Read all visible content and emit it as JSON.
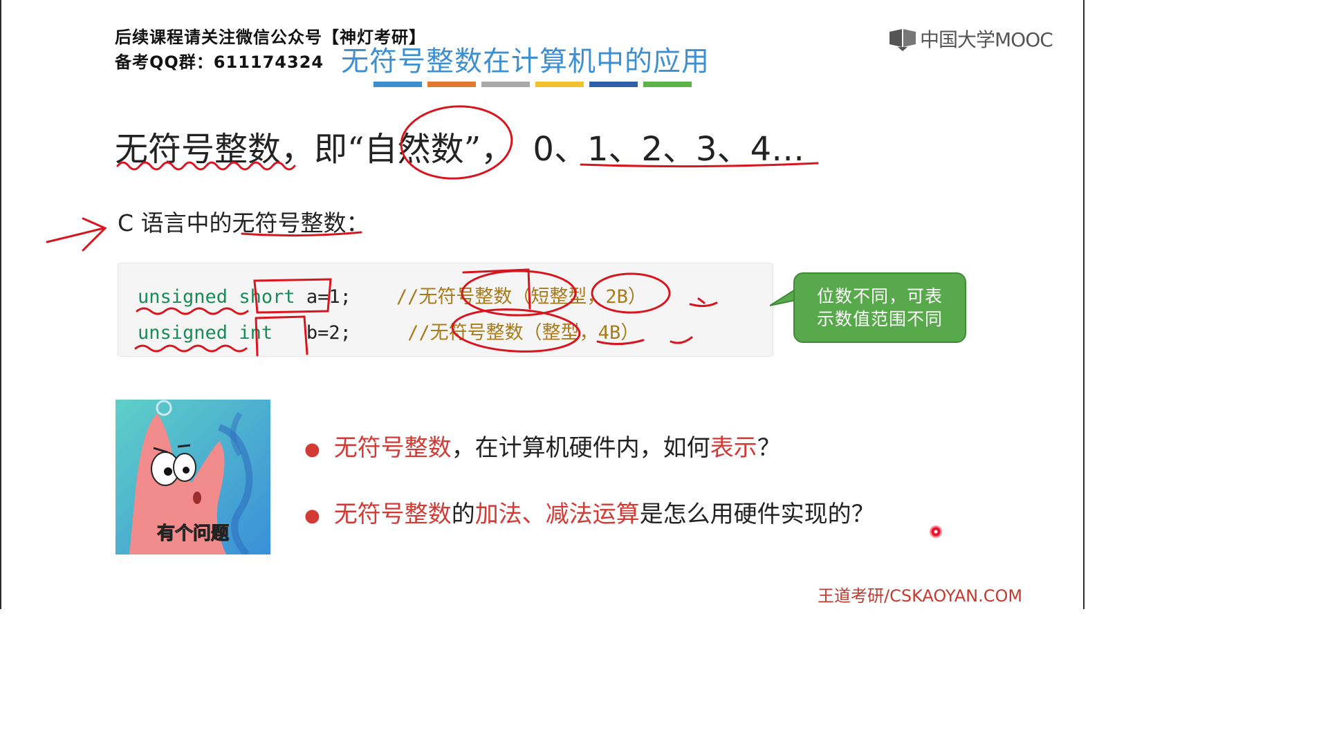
{
  "notice": {
    "line1": "后续课程请关注微信公众号【神灯考研】",
    "line2": "备考QQ群：611174324"
  },
  "title": "无符号整数在计算机中的应用",
  "title_bar_colors": [
    "#3d8fd0",
    "#e07a2f",
    "#a9a9a9",
    "#f2c12e",
    "#2f5fa8",
    "#5cb347"
  ],
  "logo": {
    "text": "中国大学MOOC",
    "icon": "mooc-book-icon"
  },
  "headline": {
    "part1": "无符号整数，即",
    "quote_open": "“",
    "natural": "自然数",
    "quote_close": "”",
    "comma": "，",
    "sequence": "0、1、2、3、4…"
  },
  "subheading": "C 语言中的无符号整数：",
  "code": [
    {
      "kw": "unsigned",
      "type": "short",
      "rest": " a=1;",
      "comment": "//无符号整数（短整型，2B）"
    },
    {
      "kw": "unsigned",
      "type": "int",
      "rest": "   b=2;",
      "comment": "//无符号整数（整型，4B）"
    }
  ],
  "callout": {
    "line1": "位数不同，可表",
    "line2": "示数值范围不同",
    "color": "#58a84c"
  },
  "image": {
    "caption": "有个问题",
    "icon": "patrick-star-illustration"
  },
  "bullets": [
    {
      "seg1": "无符号整数",
      "seg2": "，在计算机硬件内，如何",
      "seg3": "表示",
      "seg4": "？"
    },
    {
      "seg1": "无符号整数",
      "seg2": "的",
      "seg3": "加法、减法运算",
      "seg4": "是怎么用硬件实现的？"
    }
  ],
  "footer": "王道考研/CSKAOYAN.COM",
  "accent_red": "#d23a35"
}
